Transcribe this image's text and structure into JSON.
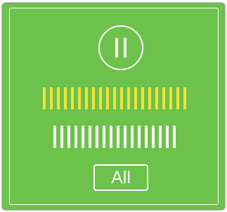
{
  "colors": {
    "background": "#6cc24a",
    "border": "#ffffff",
    "active_bars": "#f2e23a",
    "inactive_bars": "#ffffff"
  },
  "controls": {
    "pause_icon": "pause-icon",
    "all_label": "All"
  },
  "bar_rows": [
    {
      "state": "highlighted",
      "color": "#f2e23a",
      "count": 21
    },
    {
      "state": "normal",
      "color": "#ffffff",
      "count": 18
    }
  ]
}
